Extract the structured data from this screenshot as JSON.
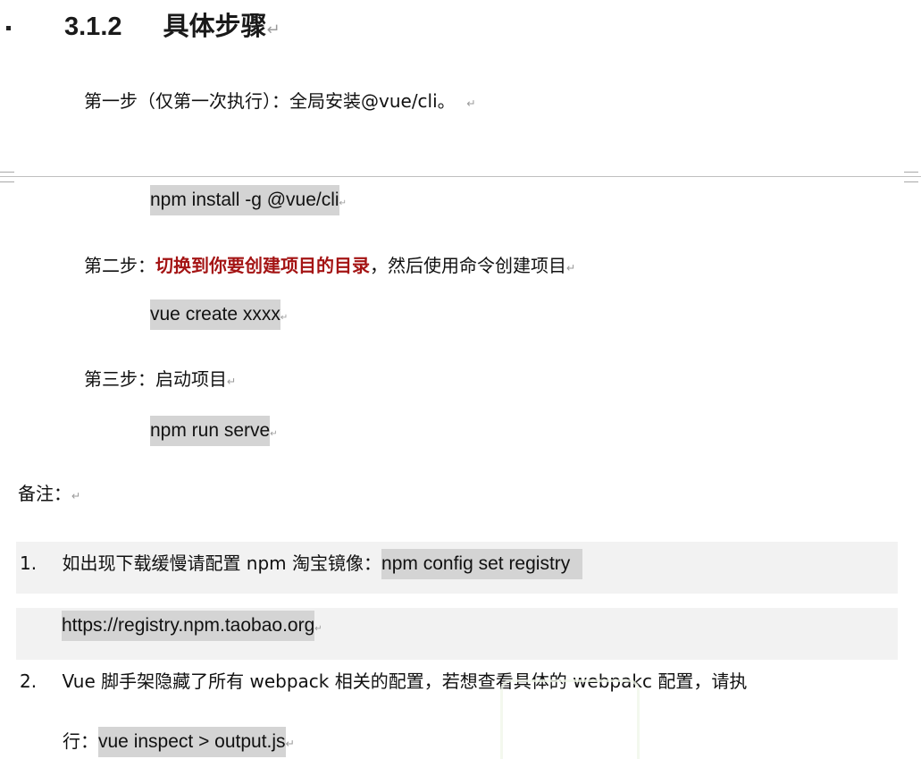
{
  "heading": {
    "number": "3.1.2",
    "title": "具体步骤",
    "mark": "↵"
  },
  "step1": {
    "text": "第一步（仅第一次执行）：全局安装@vue/cli。",
    "mark": "↵",
    "command": "npm install -g @vue/cli",
    "command_mark": "↵"
  },
  "step2": {
    "prefix": "第二步：",
    "emphasis": "切换到你要创建项目的目录",
    "suffix": "，然后使用命令创建项目",
    "mark": "↵",
    "command": "vue create xxxx",
    "command_mark": "↵"
  },
  "step3": {
    "text": "第三步：启动项目",
    "mark": "↵",
    "command": "npm run serve",
    "command_mark": "↵"
  },
  "note": {
    "label": "备注：",
    "mark": "↵",
    "items": [
      {
        "number": "1.",
        "text": "如出现下载缓慢请配置 npm 淘宝镜像：",
        "command": "npm config set registry",
        "command_cont": "https://registry.npm.taobao.org",
        "mark": "↵"
      },
      {
        "number": "2.",
        "text": "Vue 脚手架隐藏了所有 webpack 相关的配置，若想查看具体的 webpakc 配置，请执",
        "text_cont": "行：",
        "command": "vue inspect > output.js",
        "mark": "↵"
      }
    ]
  },
  "colors": {
    "emphasis": "#a41414",
    "code_background": "#d4d4d4",
    "shading": "#f2f2f2"
  }
}
